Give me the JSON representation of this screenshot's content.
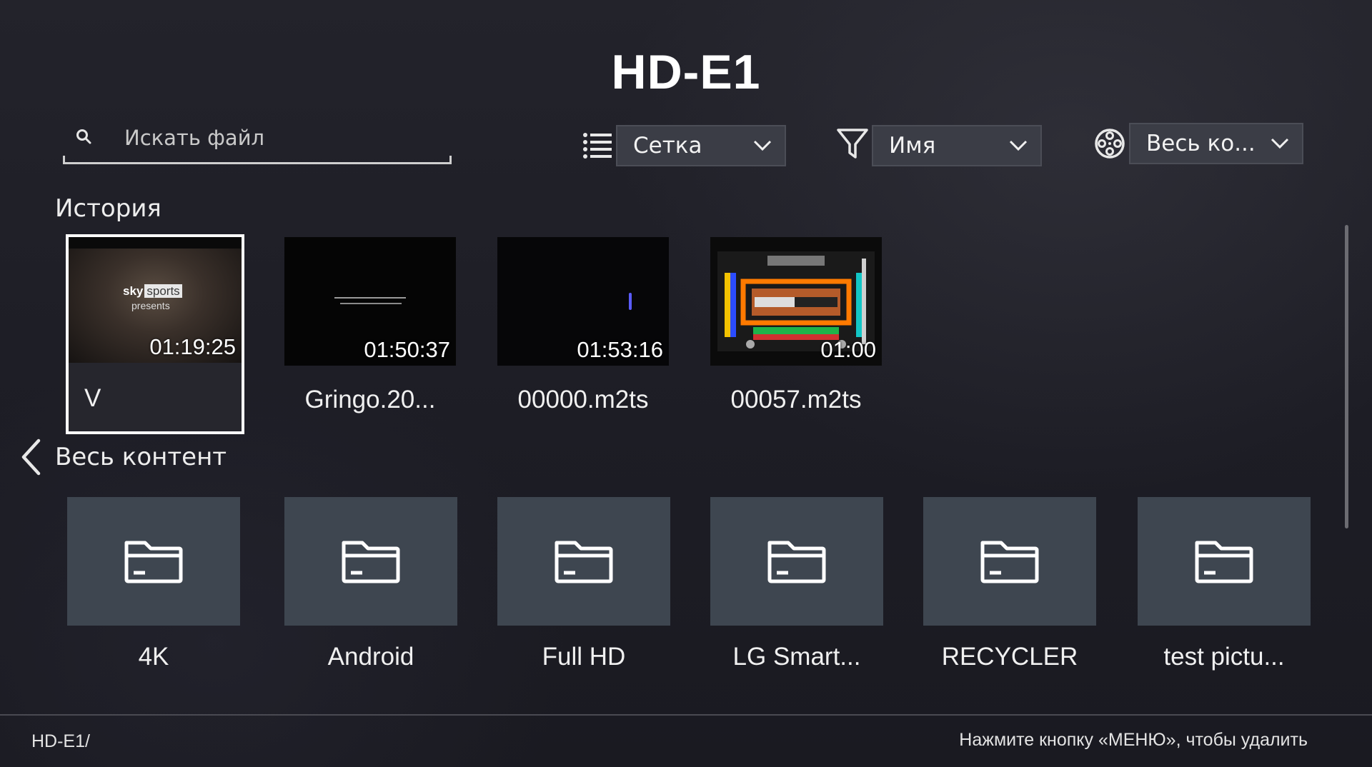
{
  "header": {
    "title": "HD-E1"
  },
  "search": {
    "placeholder": "Искать файл",
    "value": ""
  },
  "controls": {
    "view": {
      "icon": "list-icon",
      "label": "Сетка"
    },
    "sort": {
      "icon": "filter-icon",
      "label": "Имя"
    },
    "content": {
      "icon": "film-reel-icon",
      "label": "Весь ко..."
    }
  },
  "history": {
    "title": "История",
    "items": [
      {
        "name": "V",
        "time": "01:19:25",
        "focused": true
      },
      {
        "name": "Gringo.20...",
        "time": "01:50:37"
      },
      {
        "name": "00000.m2ts",
        "time": "01:53:16"
      },
      {
        "name": "00057.m2ts",
        "time": "01:00"
      }
    ],
    "thumb_texts": {
      "sky_logo_brand": "sky",
      "sky_logo_product": "sports",
      "sky_presents": "presents"
    }
  },
  "content": {
    "back_icon": "chevron-left-icon",
    "title": "Весь контент",
    "folders": [
      {
        "name": "4K"
      },
      {
        "name": "Android"
      },
      {
        "name": "Full HD"
      },
      {
        "name": "LG Smart..."
      },
      {
        "name": "RECYCLER"
      },
      {
        "name": "test pictu..."
      }
    ]
  },
  "footer": {
    "path": "HD-E1/",
    "hint": "Нажмите кнопку «МЕНЮ», чтобы удалить"
  }
}
